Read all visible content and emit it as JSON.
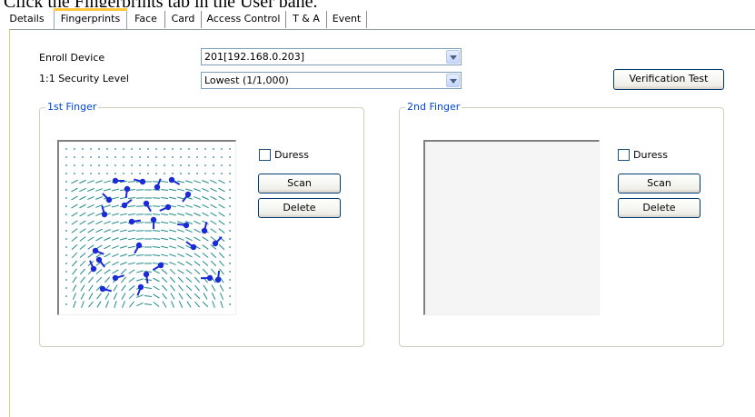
{
  "instruction": "Click the Fingerprints tab in the User pane.",
  "tabs": [
    "Details",
    "Fingerprints",
    "Face",
    "Card",
    "Access Control",
    "T & A",
    "Event"
  ],
  "active_tab": "Fingerprints",
  "enroll": {
    "device_label": "Enroll Device",
    "device_value": "201[192.168.0.203]",
    "security_label": "1:1 Security Level",
    "security_value": "Lowest (1/1,000)"
  },
  "verification_button": "Verification Test",
  "finger1": {
    "title": "1st Finger",
    "duress": "Duress",
    "scan": "Scan",
    "delete": "Delete"
  },
  "finger2": {
    "title": "2nd Finger",
    "duress": "Duress",
    "scan": "Scan",
    "delete": "Delete"
  },
  "colors": {
    "group_title": "#0046d5",
    "ridge": "#1f8a8a",
    "minutia": "#1a2bd6",
    "panel_edge": "#f3c77a"
  },
  "icons": {
    "dropdown": "chevron-down-icon",
    "fingerprint": "fingerprint-image-icon"
  }
}
